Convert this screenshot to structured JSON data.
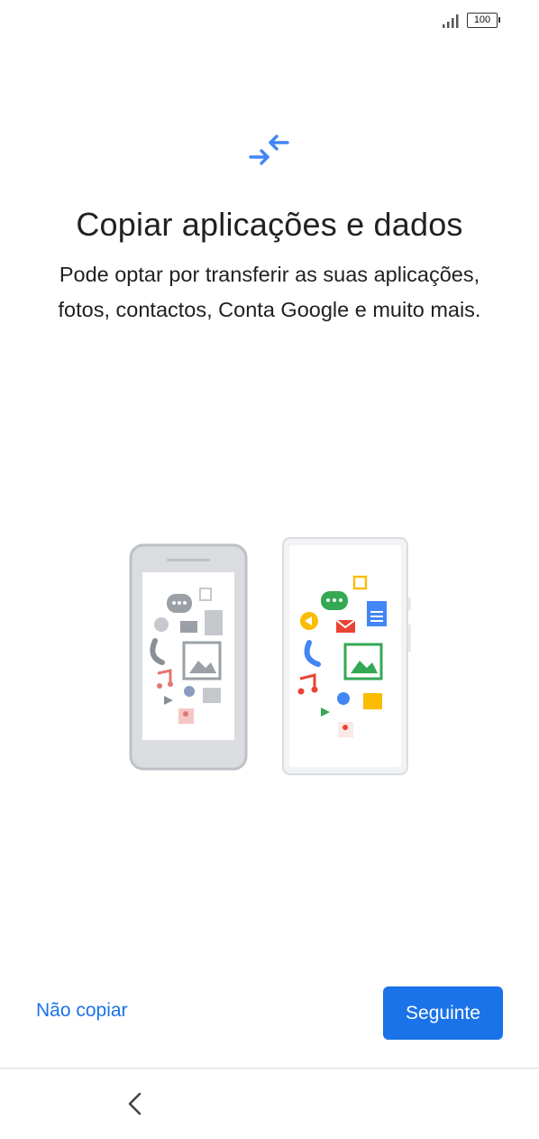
{
  "status_bar": {
    "signal_icon": "signal-icon",
    "battery_level": "100"
  },
  "header": {
    "icon": "transfer-arrows-icon",
    "title": "Copiar aplicações e dados",
    "subtitle": "Pode optar por transferir as suas aplicações, fotos, contactos, Conta Google e muito mais."
  },
  "illustration": {
    "name": "phones-transfer-illustration",
    "icons": [
      "chat-icon",
      "calendar-icon",
      "send-icon",
      "mail-icon",
      "document-icon",
      "phone-icon",
      "image-icon",
      "music-icon",
      "settings-icon",
      "folder-icon",
      "play-icon",
      "contact-icon"
    ]
  },
  "actions": {
    "skip_label": "Não copiar",
    "next_label": "Seguinte"
  },
  "nav_bar": {
    "back_icon": "back-chevron-icon"
  },
  "colors": {
    "accent": "#1a73e8",
    "google_blue": "#4285f4",
    "google_green": "#34a853",
    "google_yellow": "#fbbc04",
    "google_red": "#ea4335"
  }
}
